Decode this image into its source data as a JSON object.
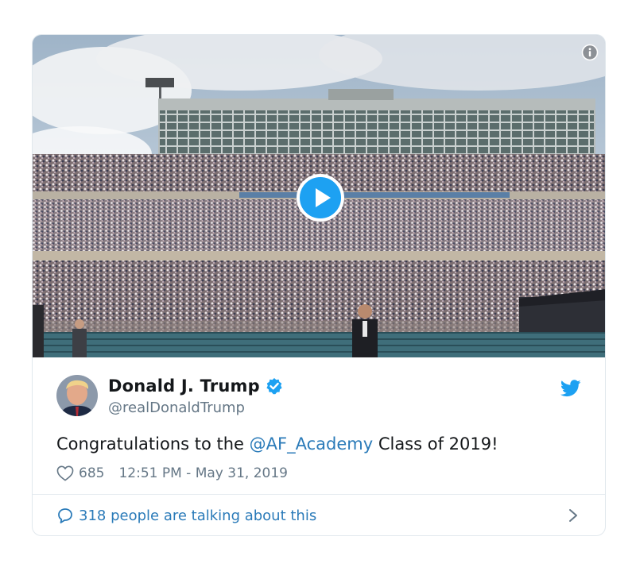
{
  "tweet": {
    "author_name": "Donald J. Trump",
    "handle": "@realDonaldTrump",
    "text_prefix": "Congratulations to the ",
    "mention": "@AF_Academy",
    "text_suffix": " Class of 2019!",
    "like_count": "685",
    "timestamp": "12:51 PM - May 31, 2019"
  },
  "footer": {
    "talking_label": "318 people are talking about this"
  },
  "icons": {
    "media_info": "info-icon",
    "media_play": "play-icon",
    "verified": "verified-badge-icon",
    "brand": "twitter-bird-icon",
    "like": "heart-icon",
    "conversation": "speech-bubble-icon",
    "more": "chevron-right-icon"
  },
  "colors": {
    "brand_blue": "#1da1f2",
    "link_blue": "#2b7bb9",
    "text_dark": "#14171a",
    "text_muted": "#657786",
    "border": "#e1e8ed"
  }
}
